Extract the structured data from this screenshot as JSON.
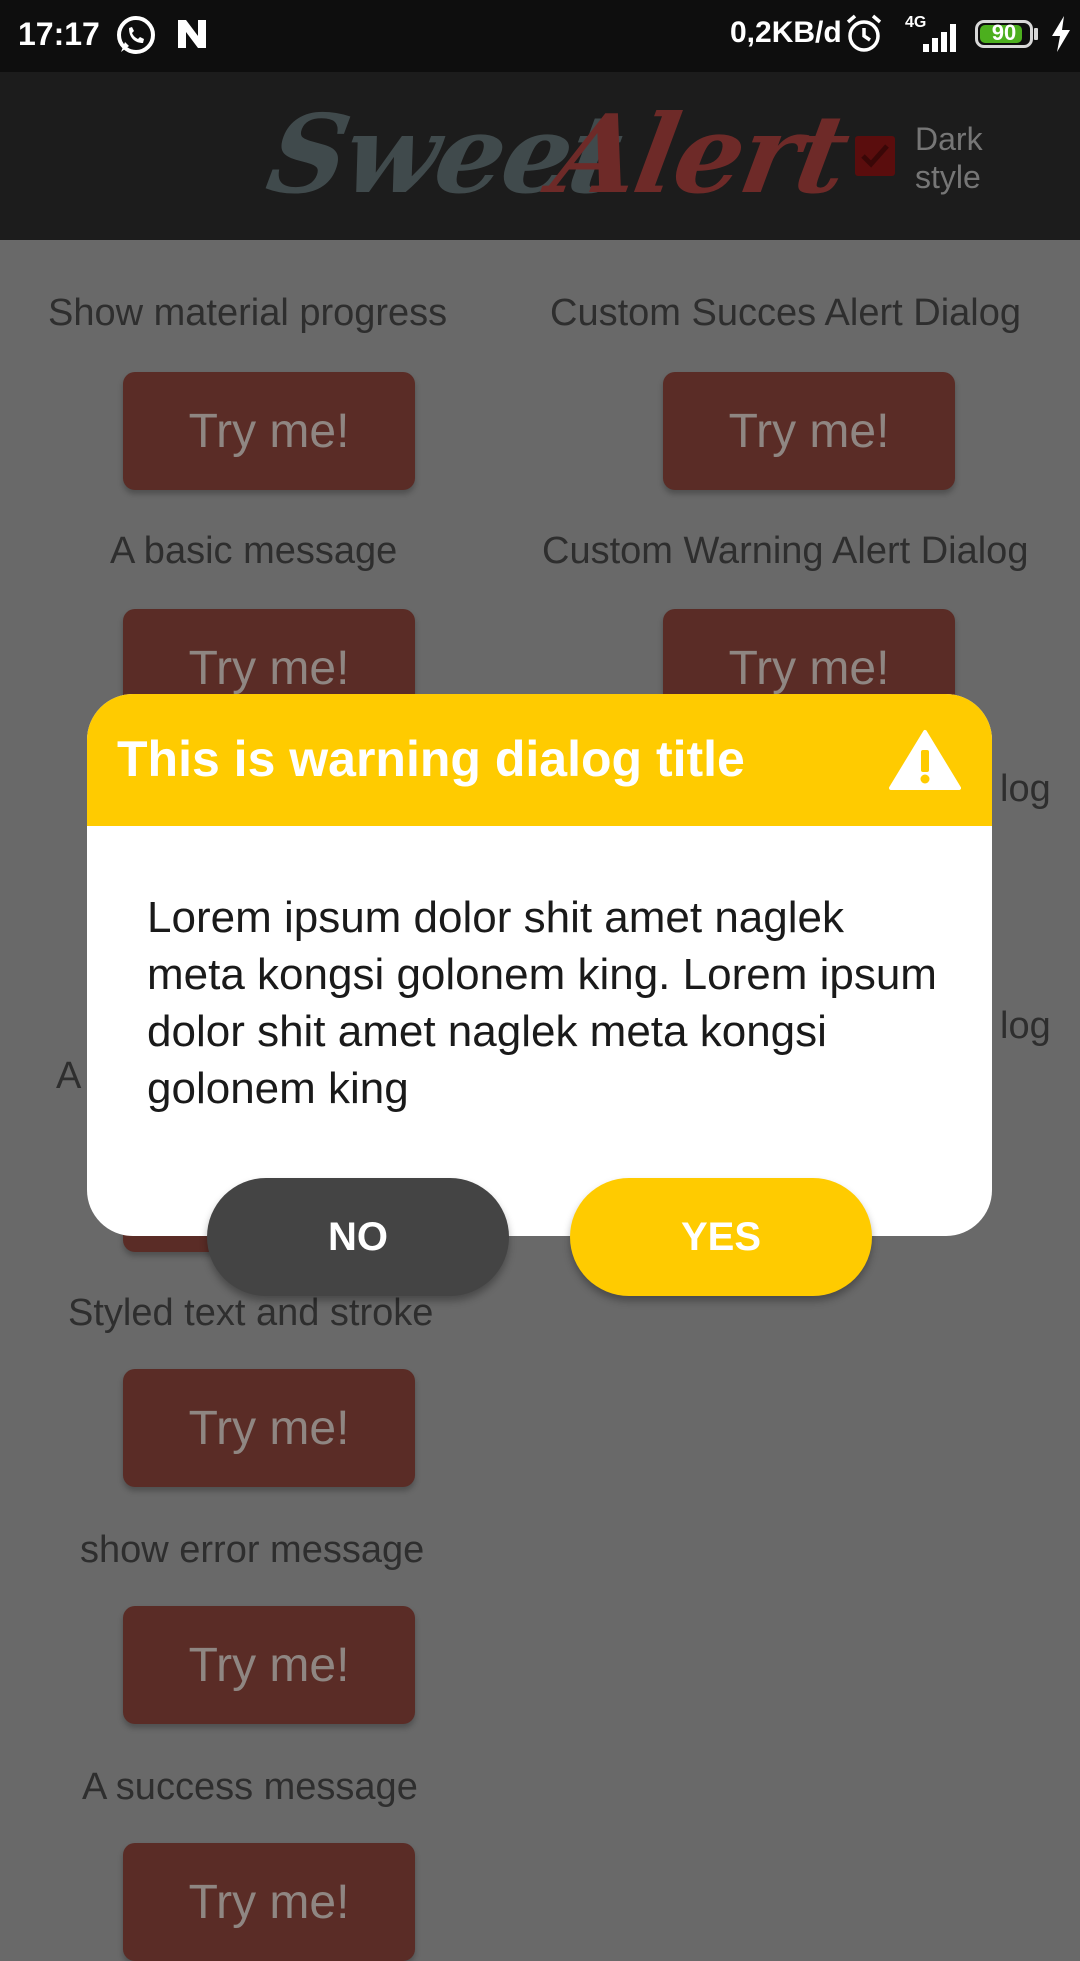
{
  "status_bar": {
    "time": "17:17",
    "net_rate": "0,2KB/d",
    "network": "4G",
    "battery": "90",
    "icons": [
      "whatsapp-icon",
      "n-app-icon",
      "alarm-icon",
      "signal-icon",
      "battery-icon",
      "charging-icon"
    ]
  },
  "header": {
    "logo_word1": "Sweet",
    "logo_word2": "Alert",
    "dark_style_label": "Dark style",
    "dark_style_checked": true,
    "colors": {
      "logo_sweet": "#404a4c",
      "logo_alert": "#6e2a28"
    }
  },
  "content": {
    "button_label": "Try me!",
    "left_column": [
      "Show material progress",
      "A basic message",
      "Styled text and stroke",
      "show error message",
      "A success message"
    ],
    "right_column": [
      "Custom Succes Alert Dialog",
      "Custom Warning Alert Dialog"
    ],
    "partial_right_1": "log",
    "partial_right_2": "log",
    "partial_left": "A"
  },
  "dialog": {
    "title": "This is warning dialog title",
    "message": "Lorem ipsum dolor shit amet naglek meta kongsi golonem king. Lorem ipsum dolor shit amet naglek meta kongsi golonem king",
    "no_label": "NO",
    "yes_label": "YES",
    "icon": "warning-icon",
    "colors": {
      "accent": "#ffcb00",
      "no_button": "#444444"
    }
  }
}
